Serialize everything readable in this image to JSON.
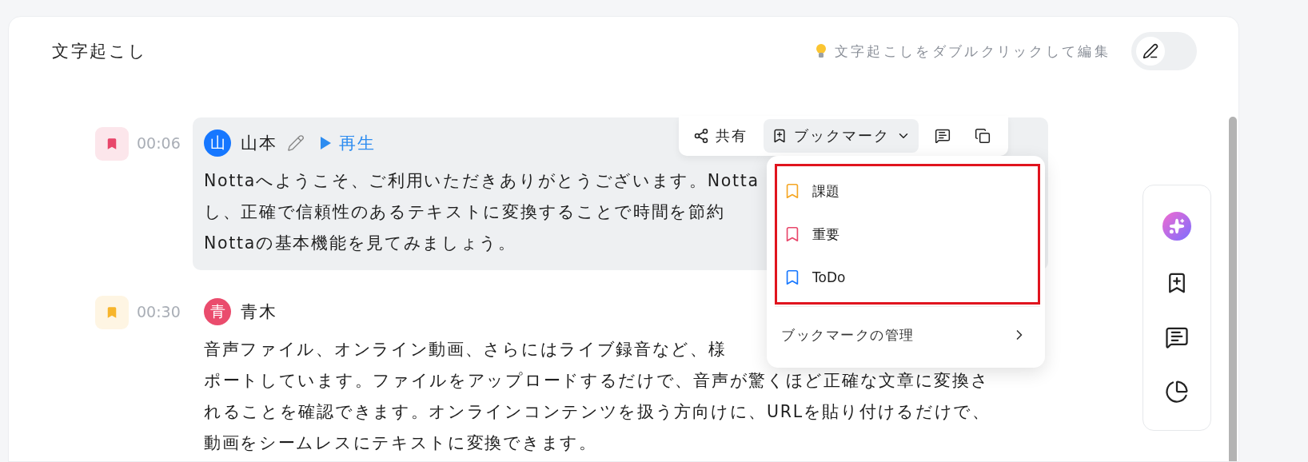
{
  "header": {
    "title": "文字起こし",
    "hint": "文字起こしをダブルクリックして編集",
    "edit_toggle": {
      "on": false
    }
  },
  "entries": [
    {
      "selected": true,
      "bookmark": {
        "color": "#e8466a"
      },
      "time": "00:06",
      "avatar": {
        "text": "山",
        "color": "#1677ff"
      },
      "speaker": "山本",
      "editable": true,
      "play_label": "再生",
      "lines": [
        "Nottaへようこそ、ご利用いただきありがとうございます。Notta",
        "し、正確で信頼性のあるテキストに変換することで時間を節約",
        "Nottaの基本機能を見てみましょう。"
      ]
    },
    {
      "selected": false,
      "bookmark": {
        "color": "#f7b52c"
      },
      "time": "00:30",
      "avatar": {
        "text": "青",
        "color": "#ea4c6d"
      },
      "speaker": "青木",
      "editable": false,
      "lines": [
        "音声ファイル、オンライン動画、さらにはライブ録音など、様",
        "ポートしています。ファイルをアップロードするだけで、音声が驚くほど正確な文章に変換さ",
        "れることを確認できます。オンラインコンテンツを扱う方向けに、URLを貼り付けるだけで、",
        "動画をシームレスにテキストに変換できます。"
      ]
    }
  ],
  "toolbar": {
    "share_label": "共有",
    "bookmark_label": "ブックマーク",
    "bookmark_expanded": true
  },
  "bookmark_menu": {
    "highlight_box": true,
    "items": [
      {
        "label": "課題",
        "color": "#f5a623"
      },
      {
        "label": "重要",
        "color": "#e8466a"
      },
      {
        "label": "ToDo",
        "color": "#1677ff"
      }
    ],
    "manage_label": "ブックマークの管理"
  }
}
